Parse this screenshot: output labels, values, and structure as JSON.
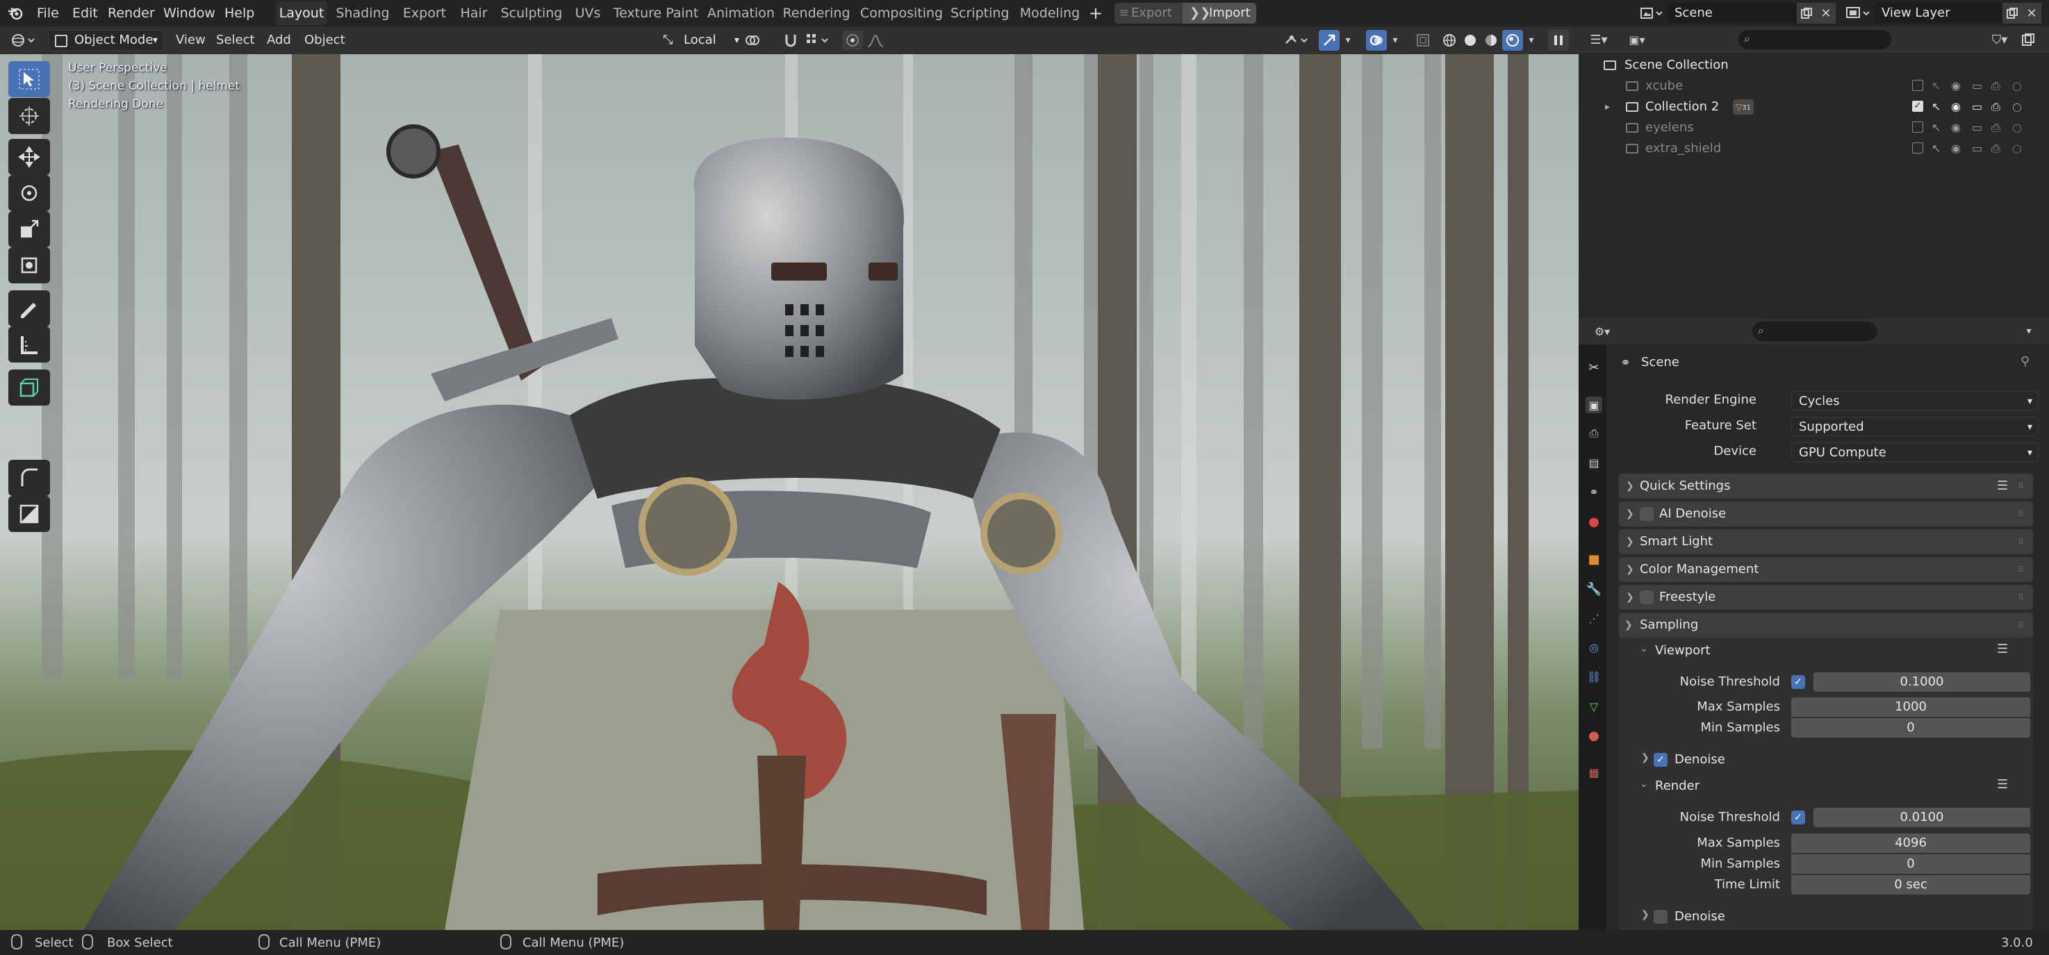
{
  "app": {
    "version": "3.0.0"
  },
  "menu": [
    "File",
    "Edit",
    "Render",
    "Window",
    "Help"
  ],
  "workspaces": [
    {
      "label": "Layout",
      "active": true
    },
    {
      "label": "Shading"
    },
    {
      "label": "Export"
    },
    {
      "label": "Hair"
    },
    {
      "label": "Sculpting"
    },
    {
      "label": "UVs"
    },
    {
      "label": "Texture Paint"
    },
    {
      "label": "Animation"
    },
    {
      "label": "Rendering"
    },
    {
      "label": "Compositing"
    },
    {
      "label": "Scripting"
    },
    {
      "label": "Modeling"
    }
  ],
  "topbar": {
    "add_tab": "+",
    "export_label": "Export",
    "import_label": "Import",
    "scene": "Scene",
    "view_layer": "View Layer"
  },
  "viewport_header": {
    "mode": "Object Mode",
    "menus": [
      "View",
      "Select",
      "Add",
      "Object"
    ],
    "transform_orientation": "Local"
  },
  "viewport_overlay": {
    "line1": "User Perspective",
    "line2": "(3) Scene Collection | helmet",
    "line3": "Rendering Done"
  },
  "outliner": {
    "root": "Scene Collection",
    "items": [
      {
        "label": "xcube",
        "visible": false,
        "checked": false
      },
      {
        "label": "Collection 2",
        "visible": true,
        "checked": true,
        "badge": "31"
      },
      {
        "label": "eyelens",
        "visible": false,
        "checked": false
      },
      {
        "label": "extra_shield",
        "visible": false,
        "checked": false
      }
    ]
  },
  "properties": {
    "context": "Scene",
    "render_engine_label": "Render Engine",
    "render_engine": "Cycles",
    "feature_set_label": "Feature Set",
    "feature_set": "Supported",
    "device_label": "Device",
    "device": "GPU Compute",
    "panels": {
      "quick_settings": "Quick Settings",
      "ai_denoise": "AI Denoise",
      "smart_light": "Smart Light",
      "color_management": "Color Management",
      "freestyle": "Freestyle",
      "sampling": "Sampling"
    },
    "viewport": {
      "title": "Viewport",
      "noise_threshold_label": "Noise Threshold",
      "noise_threshold": "0.1000",
      "max_samples_label": "Max Samples",
      "max_samples": "1000",
      "min_samples_label": "Min Samples",
      "min_samples": "0",
      "denoise_label": "Denoise"
    },
    "render": {
      "title": "Render",
      "noise_threshold_label": "Noise Threshold",
      "noise_threshold": "0.0100",
      "max_samples_label": "Max Samples",
      "max_samples": "4096",
      "min_samples_label": "Min Samples",
      "min_samples": "0",
      "time_limit_label": "Time Limit",
      "time_limit": "0 sec",
      "denoise_label": "Denoise"
    }
  },
  "statusbar": {
    "select": "Select",
    "box_select": "Box Select",
    "call_menu_1": "Call Menu (PME)",
    "call_menu_2": "Call Menu (PME)"
  },
  "colors": {
    "accent": "#4772b3",
    "panel_bg": "#282828",
    "header_bg": "#303030",
    "field": "#545454"
  }
}
